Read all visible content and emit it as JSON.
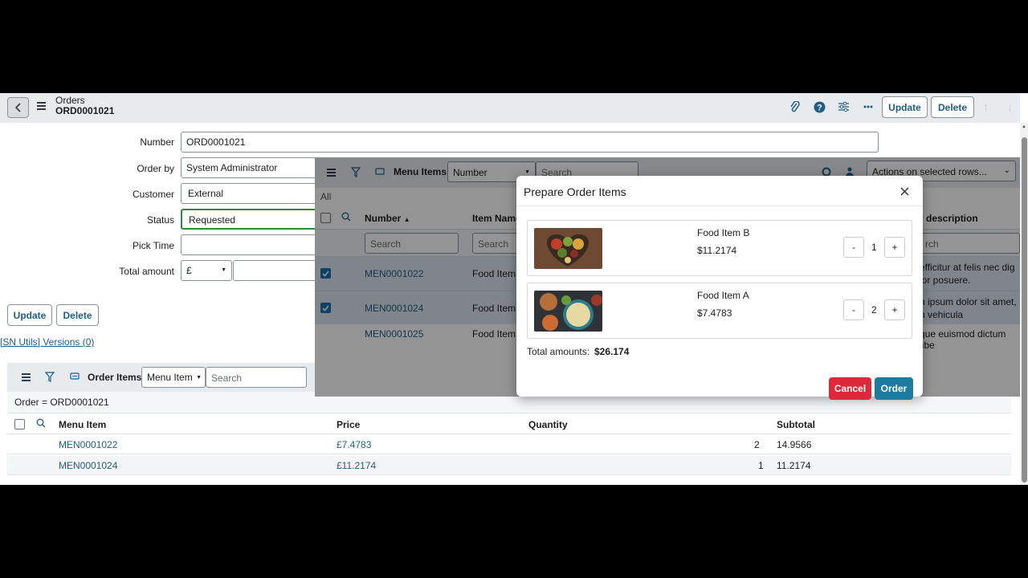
{
  "header": {
    "table": "Orders",
    "record": "ORD0001021",
    "update_label": "Update",
    "delete_label": "Delete"
  },
  "form": {
    "number_label": "Number",
    "number_value": "ORD0001021",
    "orderby_label": "Order by",
    "orderby_value": "System Administrator",
    "customer_label": "Customer",
    "customer_value": "External",
    "status_label": "Status",
    "status_value": "Requested",
    "picktime_label": "Pick Time",
    "picktime_value": "",
    "total_label": "Total amount",
    "currency_value": "£",
    "update_label": "Update",
    "delete_label": "Delete",
    "versions_link": "[SN Utils] Versions (0)"
  },
  "related_list": {
    "title": "Order Items",
    "field_select": "Menu Item",
    "search_placeholder": "Search",
    "filter_text": "Order = ORD0001021",
    "columns": [
      "Menu Item",
      "Price",
      "Quantity",
      "Subtotal"
    ],
    "rows": [
      {
        "menu_item": "MEN0001022",
        "price": "£7.4783",
        "quantity": "2",
        "subtotal": "14.9566"
      },
      {
        "menu_item": "MEN0001024",
        "price": "£11.2174",
        "quantity": "1",
        "subtotal": "11.2174"
      }
    ]
  },
  "menu_list": {
    "title": "Menu Items",
    "field_select": "Number",
    "search_placeholder": "Search",
    "actions_select": "Actions on selected rows...",
    "all_label": "All",
    "col_number": "Number",
    "col_item_name": "Item Name",
    "col_description": "r description",
    "search_1": "Search",
    "search_2": "Search",
    "search_3": "rch",
    "rows": [
      {
        "number": "MEN0001022",
        "name": "Food Item",
        "desc1": "efficitur at felis nec dig",
        "desc2": "lor posuere.",
        "checked": true
      },
      {
        "number": "MEN0001024",
        "name": "Food Item",
        "desc1": "n ipsum dolor sit amet,",
        "desc2": "n vehicula",
        "checked": true
      },
      {
        "number": "MEN0001025",
        "name": "Food Item",
        "desc1": "que euismod dictum libe",
        "desc2": "",
        "checked": false
      }
    ]
  },
  "modal": {
    "title": "Prepare Order Items",
    "items": [
      {
        "name": "Food Item B",
        "price": "$11.2174",
        "qty": "1"
      },
      {
        "name": "Food Item A",
        "price": "$7.4783",
        "qty": "2"
      }
    ],
    "total_label": "Total amounts:",
    "total_value": "$26.174",
    "cancel_label": "Cancel",
    "order_label": "Order",
    "minus": "-",
    "plus": "+"
  },
  "colors": {
    "link": "#1f5d86",
    "cancel": "#e0283b",
    "order": "#1b7ca1",
    "checkbox": "#1b6fae"
  }
}
